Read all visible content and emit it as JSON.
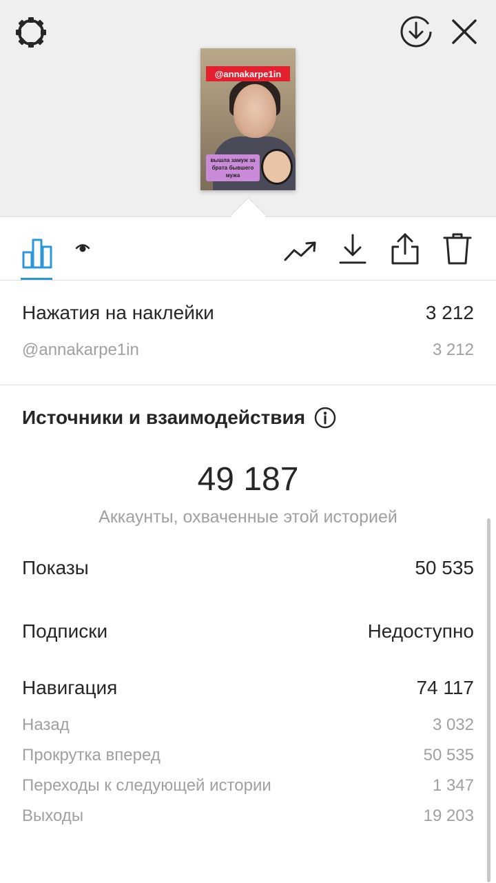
{
  "story_preview": {
    "mention_tag": "@annakarpe1in",
    "caption": "вышла замуж за брата бывшего мужа"
  },
  "top_bar": {
    "icons": [
      "settings-icon",
      "download-circle-icon",
      "close-icon"
    ]
  },
  "tabs": {
    "active": "insights",
    "icons": [
      "bar-chart-icon",
      "eye-icon"
    ],
    "action_icons": [
      "trend-icon",
      "download-icon",
      "share-icon",
      "trash-icon"
    ],
    "accent_color": "#2b96d8"
  },
  "sticker_taps": {
    "label": "Нажатия на наклейки",
    "value": "3 212",
    "items": [
      {
        "label": "@annakarpe1in",
        "value": "3 212"
      }
    ]
  },
  "discovery": {
    "title": "Источники и взаимодействия",
    "reach_value": "49 187",
    "reach_label": "Аккаунты, охваченные этой историей",
    "impressions": {
      "label": "Показы",
      "value": "50 535"
    },
    "follows": {
      "label": "Подписки",
      "value": "Недоступно"
    },
    "navigation": {
      "label": "Навигация",
      "value": "74 117",
      "items": [
        {
          "label": "Назад",
          "value": "3 032"
        },
        {
          "label": "Прокрутка вперед",
          "value": "50 535"
        },
        {
          "label": "Переходы к следующей истории",
          "value": "1 347"
        },
        {
          "label": "Выходы",
          "value": "19 203"
        }
      ]
    }
  }
}
